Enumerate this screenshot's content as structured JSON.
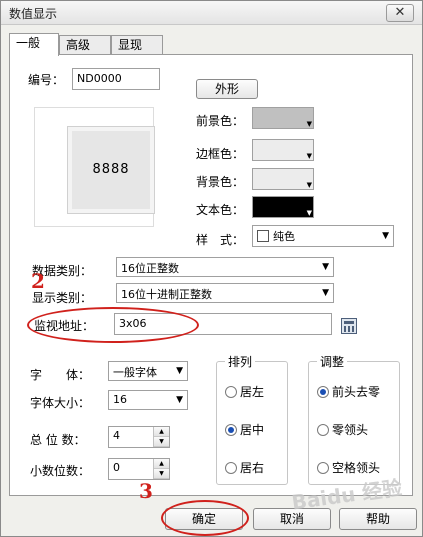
{
  "window": {
    "title": "数值显示",
    "close_glyph": "✕"
  },
  "tabs": [
    {
      "label": "一般"
    },
    {
      "label": "高级"
    },
    {
      "label": "显现"
    }
  ],
  "general": {
    "id_label": "编号：",
    "id_value": "ND0000",
    "shape_button": "外形",
    "preview_text": "8888",
    "fg_color_label": "前景色：",
    "border_color_label": "边框色：",
    "bg_color_label": "背景色：",
    "text_color_label": "文本色：",
    "style_label": "样　式：",
    "style_value": "纯色",
    "data_type_label": "数据类别：",
    "data_type_value": "16位正整数",
    "display_type_label": "显示类别：",
    "display_type_value": "16位十进制正整数",
    "monitor_addr_label": "监视地址：",
    "monitor_addr_value": "3x06",
    "font_label": "字　　体：",
    "font_value": "一般字体",
    "font_size_label": "字体大小：",
    "font_size_value": "16",
    "total_digits_label": "总 位 数：",
    "total_digits_value": "4",
    "decimal_digits_label": "小数位数：",
    "decimal_digits_value": "0"
  },
  "align_group": {
    "title": "排列",
    "options": [
      {
        "label": "居左",
        "selected": false
      },
      {
        "label": "居中",
        "selected": true
      },
      {
        "label": "居右",
        "selected": false
      }
    ]
  },
  "adjust_group": {
    "title": "调整",
    "options": [
      {
        "label": "前头去零",
        "selected": true
      },
      {
        "label": "零领头",
        "selected": false
      },
      {
        "label": "空格领头",
        "selected": false
      }
    ]
  },
  "footer": {
    "ok": "确定",
    "cancel": "取消",
    "help": "帮助"
  },
  "annotations": {
    "step2": "2",
    "step3": "3"
  },
  "watermark": "Baidu 经验",
  "colors": {
    "fg_swatch": "#c0c0c0",
    "border_swatch": "#ececec",
    "bg_swatch": "#ececec",
    "text_swatch": "#000000",
    "annotation_red": "#d0211c",
    "radio_selected": "#1a4fb3"
  }
}
